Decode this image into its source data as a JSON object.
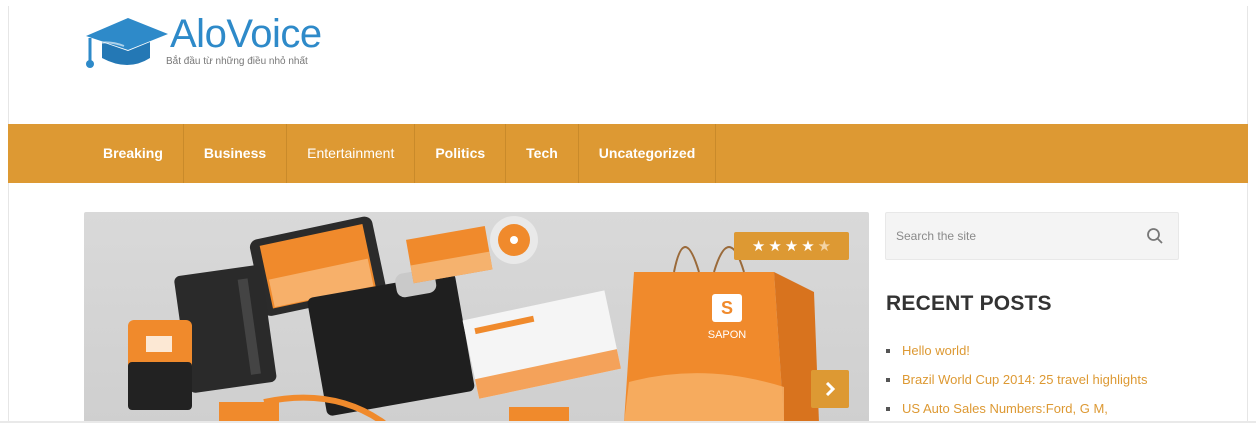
{
  "brand": {
    "title": "AloVoice",
    "tagline": "Bắt đầu từ những điều nhỏ nhất",
    "accent_color": "#dd9933",
    "logo_color": "#2e8ac9"
  },
  "nav": {
    "items": [
      {
        "label": "Breaking"
      },
      {
        "label": "Business"
      },
      {
        "label": "Entertainment"
      },
      {
        "label": "Politics"
      },
      {
        "label": "Tech"
      },
      {
        "label": "Uncategorized"
      }
    ]
  },
  "slider": {
    "rating": 4,
    "rating_max": 5,
    "next_icon": "chevron-right-icon",
    "brand_mark": "SAPON"
  },
  "sidebar": {
    "search": {
      "placeholder": "Search the site",
      "icon": "search-icon"
    },
    "recent_title": "RECENT POSTS",
    "recent_posts": [
      {
        "title": "Hello world!"
      },
      {
        "title": "Brazil World Cup 2014: 25 travel highlights"
      },
      {
        "title": "US Auto Sales Numbers:Ford, G M,"
      }
    ]
  }
}
